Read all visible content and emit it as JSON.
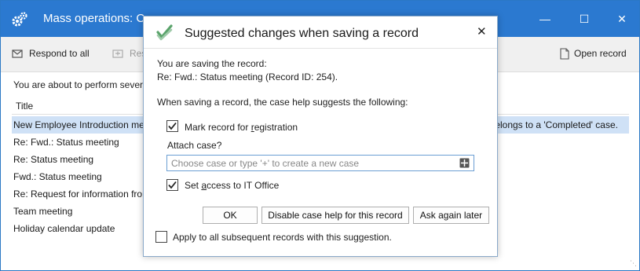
{
  "window": {
    "title": "Mass operations: C"
  },
  "toolbar": {
    "respond_all_label": "Respond to all",
    "respond_label": "Resp",
    "open_record_label": "Open record"
  },
  "main": {
    "intro_text": "You are about to perform severa",
    "column_title": "Title",
    "rows": [
      {
        "title": "New Employee Introduction me",
        "note": "elongs to a 'Completed' case."
      },
      {
        "title": "Re: Fwd.: Status meeting"
      },
      {
        "title": "Re: Status meeting"
      },
      {
        "title": "Fwd.: Status meeting"
      },
      {
        "title": "Re: Request for information fror"
      },
      {
        "title": "Team meeting"
      },
      {
        "title": "Holiday calendar update"
      }
    ]
  },
  "dialog": {
    "title": "Suggested changes when saving a record",
    "saving_line": "You are saving the record:",
    "record_line": "Re: Fwd.: Status meeting (Record ID: 254).",
    "suggestion_intro": "When saving a record, the case help suggests the following:",
    "mark_registration_label_pre": "Mark record for ",
    "mark_registration_label_u": "r",
    "mark_registration_label_post": "egistration",
    "mark_registration_checked": true,
    "attach_case_label": "Attach case?",
    "case_placeholder": "Choose case or type '+' to create a new case",
    "set_access_label_pre": "Set ",
    "set_access_label_u": "a",
    "set_access_label_post": "ccess to IT Office",
    "set_access_checked": true,
    "ok_label": "OK",
    "disable_label": "Disable case help for this record",
    "ask_again_label": "Ask again later",
    "apply_all_label": "Apply to all subsequent records with this suggestion.",
    "apply_all_checked": false
  },
  "colors": {
    "titlebar": "#2b79d0",
    "selection": "#cfe1f6",
    "check_green": "#5aa36b"
  },
  "icons": {
    "app": "gears-icon",
    "respond_all": "reply-all-icon",
    "respond": "reply-icon",
    "open_record": "document-icon",
    "dialog_logo": "double-checkmark-icon",
    "combo": "case-picker-icon"
  }
}
